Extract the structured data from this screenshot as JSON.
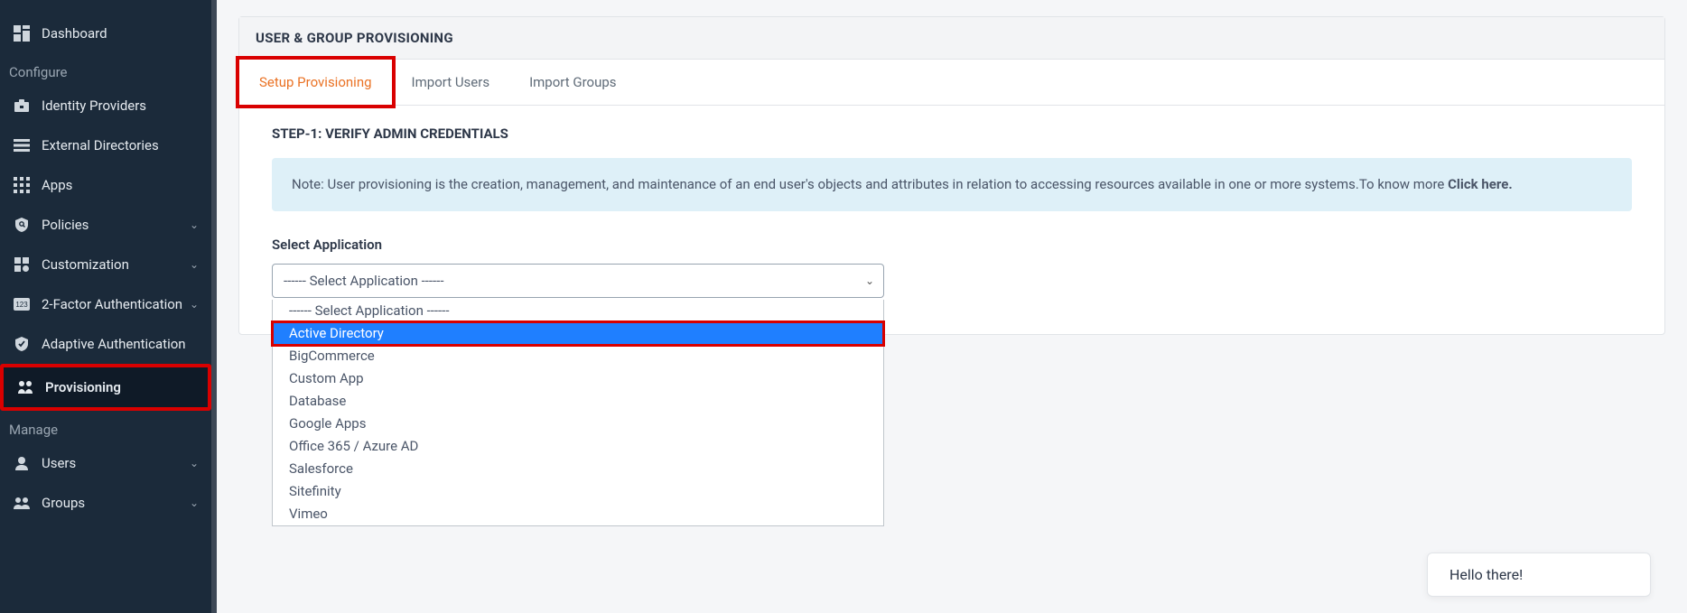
{
  "sidebar": {
    "dashboard": "Dashboard",
    "configure_section": "Configure",
    "items": [
      {
        "label": "Identity Providers",
        "has_chevron": false
      },
      {
        "label": "External Directories",
        "has_chevron": false
      },
      {
        "label": "Apps",
        "has_chevron": false
      },
      {
        "label": "Policies",
        "has_chevron": true
      },
      {
        "label": "Customization",
        "has_chevron": true
      },
      {
        "label": "2-Factor Authentication",
        "has_chevron": true
      },
      {
        "label": "Adaptive Authentication",
        "has_chevron": false
      },
      {
        "label": "Provisioning",
        "has_chevron": false
      }
    ],
    "manage_section": "Manage",
    "manage_items": [
      {
        "label": "Users",
        "has_chevron": true
      },
      {
        "label": "Groups",
        "has_chevron": true
      }
    ]
  },
  "panel": {
    "title": "USER & GROUP PROVISIONING",
    "tabs": [
      {
        "label": "Setup Provisioning",
        "active": true
      },
      {
        "label": "Import Users",
        "active": false
      },
      {
        "label": "Import Groups",
        "active": false
      }
    ],
    "step_title": "STEP-1: VERIFY ADMIN CREDENTIALS",
    "info_note_prefix": "Note: User provisioning is the creation, management, and maintenance of an end user's objects and attributes in relation to accessing resources available in one or more systems.To know more ",
    "info_link": "Click here.",
    "field_label": "Select Application",
    "select_display": "------ Select Application ------",
    "options": [
      {
        "label": "------ Select Application ------",
        "highlighted": false
      },
      {
        "label": "Active Directory",
        "highlighted": true
      },
      {
        "label": "BigCommerce",
        "highlighted": false
      },
      {
        "label": "Custom App",
        "highlighted": false
      },
      {
        "label": "Database",
        "highlighted": false
      },
      {
        "label": "Google Apps",
        "highlighted": false
      },
      {
        "label": "Office 365 / Azure AD",
        "highlighted": false
      },
      {
        "label": "Salesforce",
        "highlighted": false
      },
      {
        "label": "Sitefinity",
        "highlighted": false
      },
      {
        "label": "Vimeo",
        "highlighted": false
      }
    ]
  },
  "chat": {
    "greeting": "Hello there!"
  }
}
